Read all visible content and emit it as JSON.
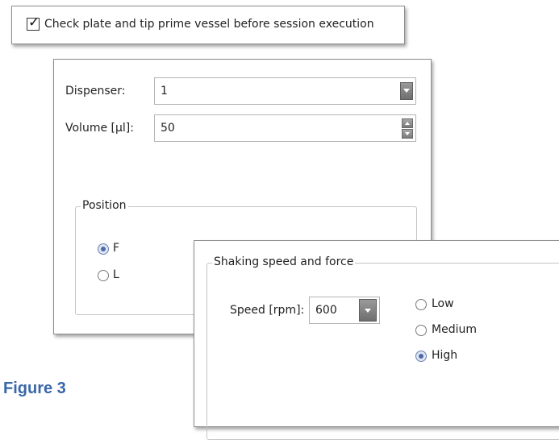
{
  "check_plate": {
    "label": "Check plate and tip prime vessel before session execution",
    "checked": true
  },
  "dispenser_panel": {
    "dispenser_label": "Dispenser:",
    "dispenser_value": "1",
    "volume_label": "Volume [µl]:",
    "volume_value": "50",
    "position_group": {
      "title": "Position",
      "options": [
        {
          "label": "F",
          "selected": true
        },
        {
          "label": "L",
          "selected": false
        }
      ]
    }
  },
  "shaking_panel": {
    "group_title": "Shaking speed and force",
    "speed_label": "Speed [rpm]:",
    "speed_value": "600",
    "force_options": [
      {
        "label": "Low",
        "selected": false
      },
      {
        "label": "Medium",
        "selected": false
      },
      {
        "label": "High",
        "selected": true
      }
    ]
  },
  "caption": "Figure 3",
  "colors": {
    "caption": "#3a67a8",
    "radio_selected": "#4d6aa8"
  }
}
